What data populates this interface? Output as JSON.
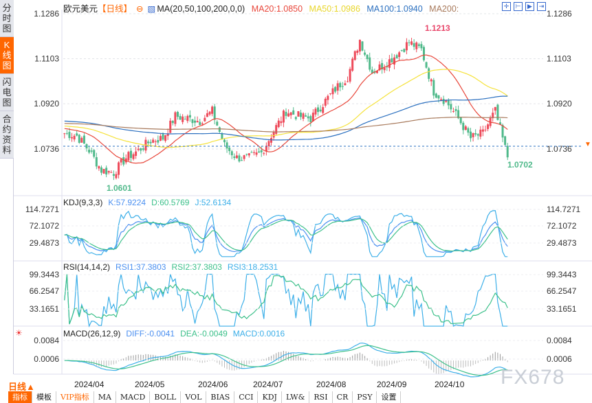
{
  "sidebar": {
    "tabs": [
      "分时图",
      "K线图",
      "闪电图",
      "合约资料"
    ],
    "active": 1
  },
  "header": {
    "symbol": "欧元美元",
    "period_tag": "【日线】",
    "ma_label": "MA(20,50,100,200,0,0)",
    "ma20": "MA20:1.0850",
    "ma50": "MA50:1.0986",
    "ma100": "MA100:1.0940",
    "ma200": "MA200:"
  },
  "colors": {
    "up": "#ee4a5a",
    "down": "#4fb98a",
    "ma20": "#e8463a",
    "ma50": "#f5e23a",
    "ma100": "#2a6fbf",
    "ma200": "#a87a5c",
    "accent": "#ff6600"
  },
  "price_axis": {
    "labels": [
      "1.1286",
      "1.1103",
      "1.0920",
      "1.0736"
    ],
    "values": [
      1.1286,
      1.1103,
      1.092,
      1.0736
    ]
  },
  "annotations": {
    "high": "1.1213",
    "low": "1.0601",
    "last": "1.0702"
  },
  "price_path_weekly": [
    1.08,
    1.079,
    1.073,
    1.065,
    1.064,
    1.07,
    1.073,
    1.077,
    1.078,
    1.087,
    1.086,
    1.085,
    1.089,
    1.075,
    1.07,
    1.07,
    1.072,
    1.081,
    1.089,
    1.087,
    1.086,
    1.092,
    1.098,
    1.103,
    1.118,
    1.105,
    1.108,
    1.112,
    1.117,
    1.114,
    1.097,
    1.093,
    1.086,
    1.078,
    1.08,
    1.089,
    1.0702
  ],
  "kdj": {
    "label": "KDJ(9,3,3)",
    "k": "K:57.9224",
    "d": "D:60.5769",
    "j": "J:52.6134",
    "axis": [
      "114.7271",
      "72.1072",
      "29.4873"
    ]
  },
  "rsi": {
    "label": "RSI(14,14,2)",
    "rsi1": "RSI1:37.3803",
    "rsi2": "RSI2:37.3803",
    "rsi3": "RSI3:18.2531",
    "axis": [
      "99.3443",
      "66.2547",
      "33.1651"
    ]
  },
  "macd": {
    "label": "MACD(26,12,9)",
    "diff": "DIFF:-0.0041",
    "dea": "DEA:-0.0049",
    "macd": "MACD:0.0016",
    "axis": [
      "0.0084",
      "0.0006"
    ]
  },
  "dates": [
    "2024/04",
    "2024/05",
    "2024/06",
    "2024/07",
    "2024/08",
    "2024/09",
    "2024/10"
  ],
  "period": "日线▲",
  "bottom_tabs": [
    "指标",
    "模板",
    "VIP指标",
    "MA",
    "MACD",
    "BOLL",
    "VOL",
    "BIAS",
    "CCI",
    "KDJ",
    "LW&",
    "RSI",
    "CR",
    "PSY",
    "设置"
  ],
  "watermark": "FX678"
}
